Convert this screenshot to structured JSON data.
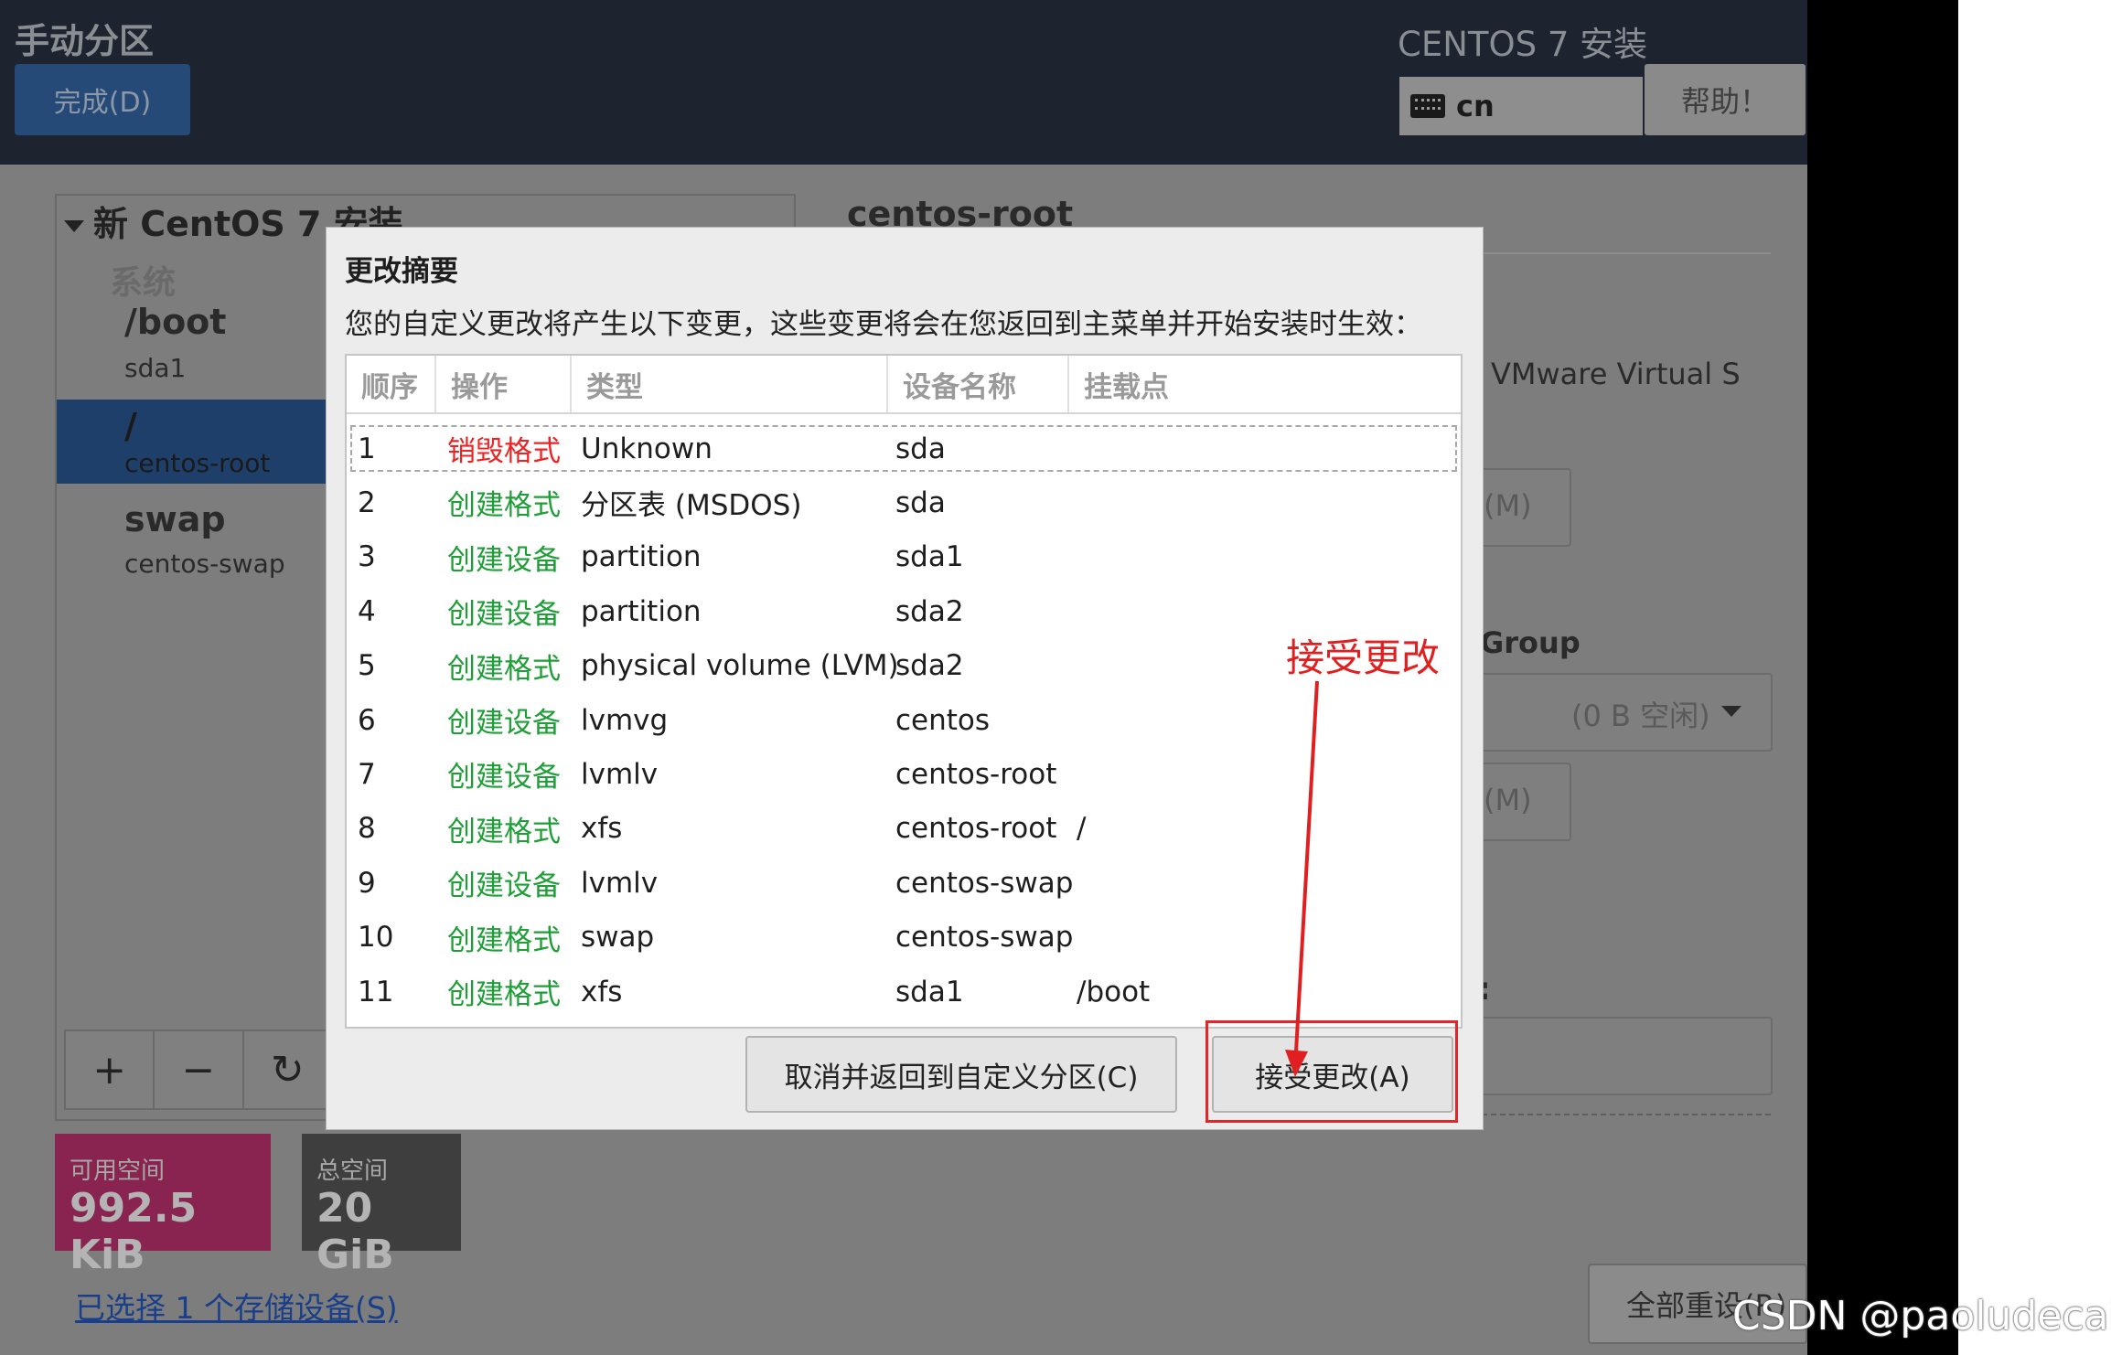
{
  "header": {
    "page_title": "手动分区",
    "done_button": "完成(D)",
    "product_title": "CENTOS 7 安装",
    "keyboard_layout": "cn",
    "help_button": "帮助！"
  },
  "left_panel": {
    "tree_title": "新 CentOS 7 安装",
    "section_label": "系统",
    "mount_points": [
      {
        "name": "/boot",
        "device": "sda1"
      },
      {
        "name": "/",
        "device": "centos-root",
        "selected": true
      },
      {
        "name": "swap",
        "device": "centos-swap"
      }
    ],
    "toolbar": {
      "add": "+",
      "remove": "−",
      "refresh": "↻"
    },
    "available_space": {
      "label": "可用空间",
      "value": "992.5 KiB",
      "color": "#88244f"
    },
    "total_space": {
      "label": "总空间",
      "value": "20 GiB"
    },
    "storage_link": "已选择 1 个存储设备(S)"
  },
  "right_panel": {
    "title": "centos-root",
    "device_text": "VMware Virtual S",
    "size_unit_1": "(M)",
    "group_label": "Group",
    "group_select": "(0 B 空闲)",
    "size_unit_2": "(M)",
    "colon_label": ":",
    "reset_button": "全部重设(R)"
  },
  "dialog": {
    "title": "更改摘要",
    "description": "您的自定义更改将产生以下变更，这些变更将会在您返回到主菜单并开始安装时生效：",
    "columns": [
      "顺序",
      "操作",
      "类型",
      "设备名称",
      "挂载点"
    ],
    "rows": [
      {
        "order": "1",
        "action": "销毁格式",
        "action_kind": "destroy",
        "type": "Unknown",
        "device": "sda",
        "mount": ""
      },
      {
        "order": "2",
        "action": "创建格式",
        "action_kind": "create",
        "type": "分区表 (MSDOS)",
        "device": "sda",
        "mount": ""
      },
      {
        "order": "3",
        "action": "创建设备",
        "action_kind": "create",
        "type": "partition",
        "device": "sda1",
        "mount": ""
      },
      {
        "order": "4",
        "action": "创建设备",
        "action_kind": "create",
        "type": "partition",
        "device": "sda2",
        "mount": ""
      },
      {
        "order": "5",
        "action": "创建格式",
        "action_kind": "create",
        "type": "physical volume (LVM)",
        "device": "sda2",
        "mount": ""
      },
      {
        "order": "6",
        "action": "创建设备",
        "action_kind": "create",
        "type": "lvmvg",
        "device": "centos",
        "mount": ""
      },
      {
        "order": "7",
        "action": "创建设备",
        "action_kind": "create",
        "type": "lvmlv",
        "device": "centos-root",
        "mount": ""
      },
      {
        "order": "8",
        "action": "创建格式",
        "action_kind": "create",
        "type": "xfs",
        "device": "centos-root",
        "mount": "/"
      },
      {
        "order": "9",
        "action": "创建设备",
        "action_kind": "create",
        "type": "lvmlv",
        "device": "centos-swap",
        "mount": ""
      },
      {
        "order": "10",
        "action": "创建格式",
        "action_kind": "create",
        "type": "swap",
        "device": "centos-swap",
        "mount": ""
      },
      {
        "order": "11",
        "action": "创建格式",
        "action_kind": "create",
        "type": "xfs",
        "device": "sda1",
        "mount": "/boot"
      }
    ],
    "cancel_button": "取消并返回到自定义分区(C)",
    "accept_button": "接受更改(A)"
  },
  "annotation": {
    "text": "接受更改",
    "color": "#e02020"
  },
  "watermark": "CSDN @paoludecaic",
  "colors": {
    "destroy": "#ee2222",
    "create": "#1e9e36",
    "header_bg": "#1d2430",
    "selected_row": "#1f3f6b"
  }
}
